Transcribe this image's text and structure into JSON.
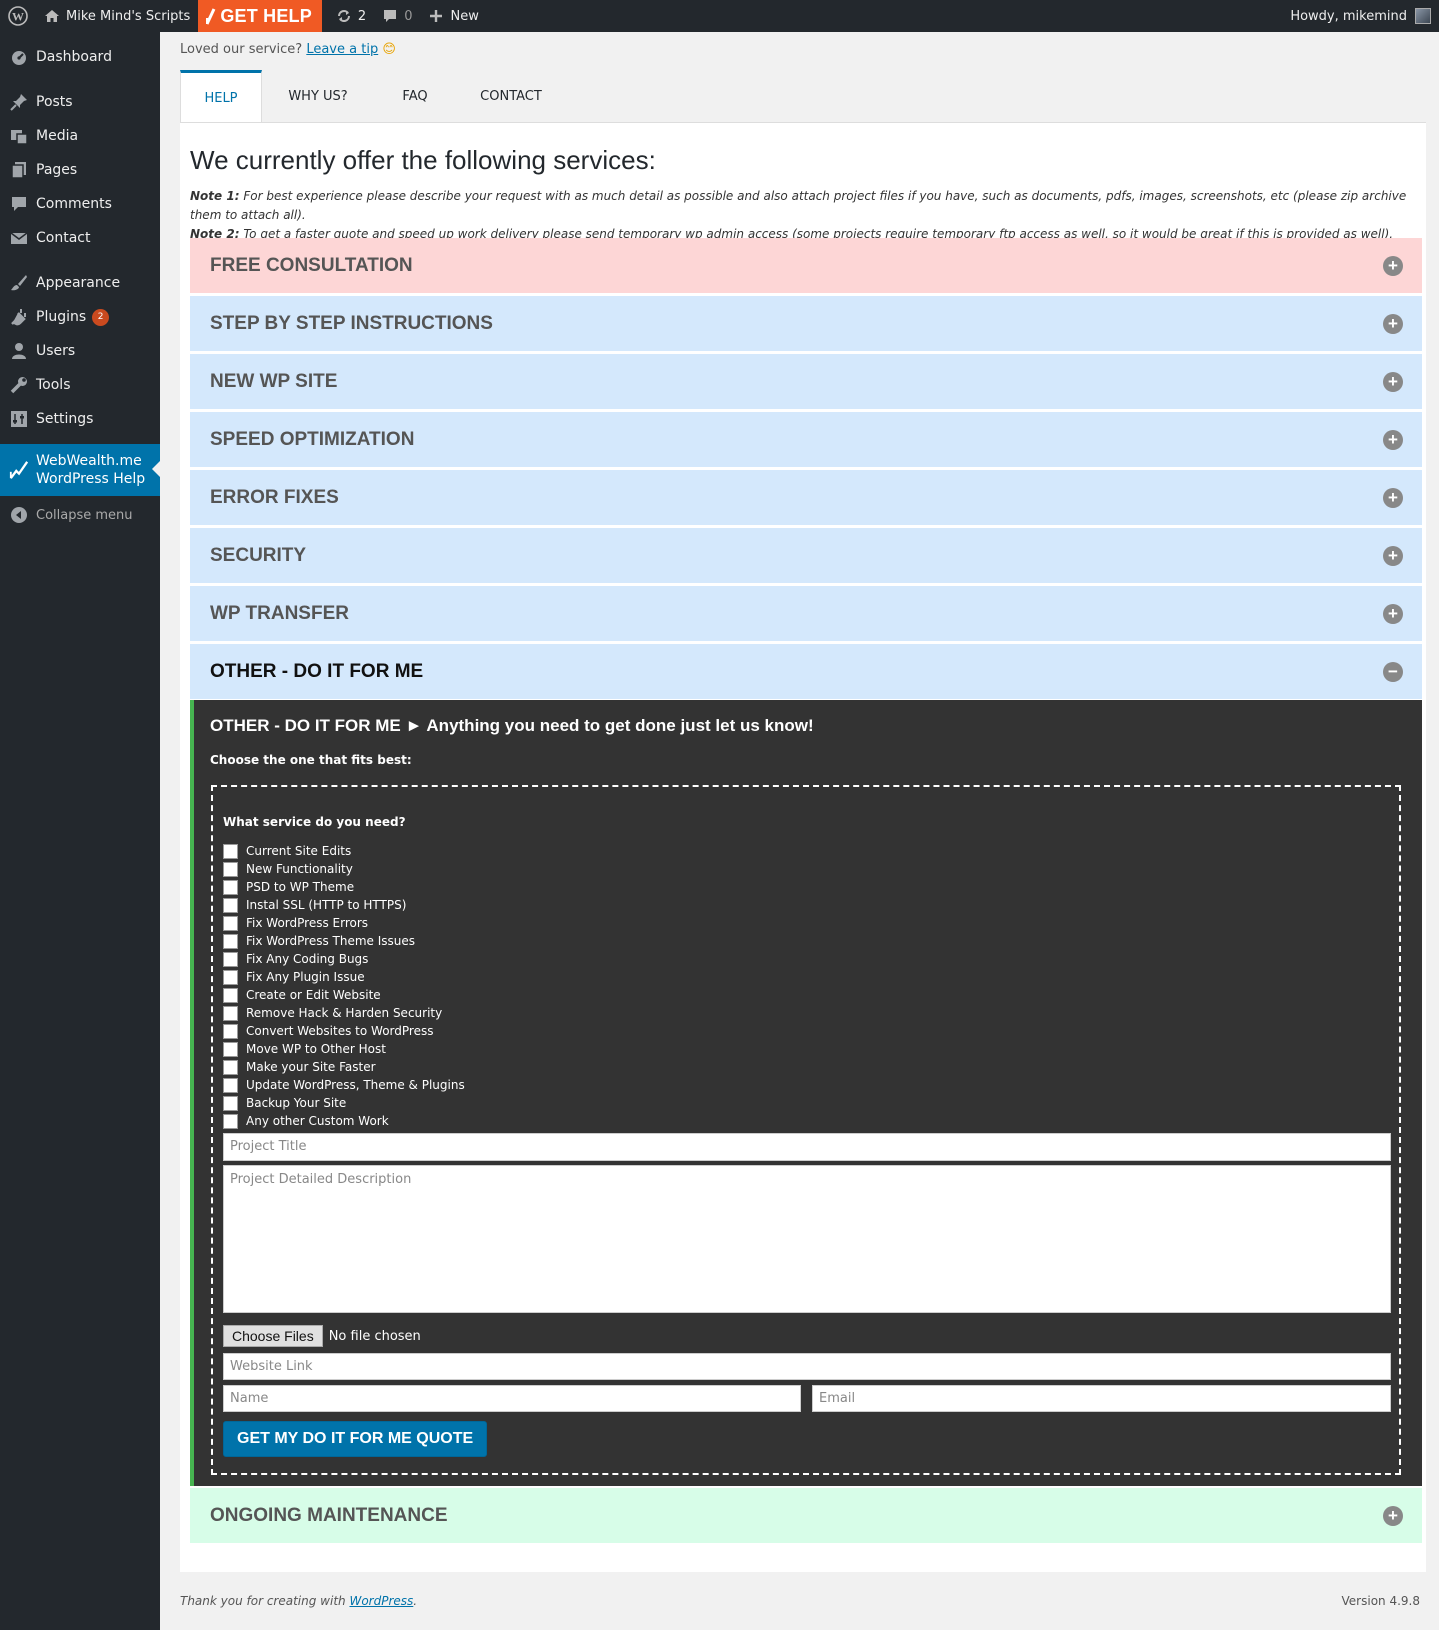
{
  "adminbar": {
    "site_name": "Mike Mind's Scripts",
    "get_help": "GET HELP",
    "updates_count": "2",
    "comments_count": "0",
    "new_label": "New",
    "howdy": "Howdy, mikemind",
    "brand_color": "#f05a24"
  },
  "sidebar": {
    "items": [
      {
        "label": "Dashboard",
        "icon": "dashboard-icon"
      },
      {
        "label": "Posts",
        "icon": "pin-icon"
      },
      {
        "label": "Media",
        "icon": "media-icon"
      },
      {
        "label": "Pages",
        "icon": "pages-icon"
      },
      {
        "label": "Comments",
        "icon": "comment-icon"
      },
      {
        "label": "Contact",
        "icon": "mail-icon"
      },
      {
        "label": "Appearance",
        "icon": "brush-icon"
      },
      {
        "label": "Plugins",
        "icon": "plugin-icon",
        "badge": "2"
      },
      {
        "label": "Users",
        "icon": "user-icon"
      },
      {
        "label": "Tools",
        "icon": "wrench-icon"
      },
      {
        "label": "Settings",
        "icon": "settings-icon"
      }
    ],
    "active_line1": "WebWealth.me",
    "active_line2": "WordPress Help",
    "collapse": "Collapse menu"
  },
  "tipline": {
    "prefix": "Loved our service?",
    "link": "Leave a tip",
    "emoji": "😊"
  },
  "tabs": [
    "HELP",
    "WHY US?",
    "FAQ",
    "CONTACT"
  ],
  "main": {
    "heading": "We currently offer the following services:",
    "note1_label": "Note 1:",
    "note1": "For best experience please describe your request with as much detail as possible and also attach project files if you have, such as documents, pdfs, images, screenshots, etc (please zip archive them to attach all).",
    "note2_label": "Note 2:",
    "note2": "To get a faster quote and speed up work delivery please send temporary wp admin access (some projects require temporary ftp access as well, so it would be great if this is provided as well).",
    "sections": [
      "FREE CONSULTATION",
      "STEP BY STEP INSTRUCTIONS",
      "NEW WP SITE",
      "SPEED OPTIMIZATION",
      "ERROR FIXES",
      "SECURITY",
      "WP TRANSFER",
      "OTHER - DO IT FOR ME",
      "ONGOING MAINTENANCE"
    ]
  },
  "form": {
    "title": "OTHER - DO IT FOR ME ► Anything you need to get done just let us know!",
    "choose": "Choose the one that fits best:",
    "question": "What service do you need?",
    "options": [
      "Current Site Edits",
      "New Functionality",
      "PSD to WP Theme",
      "Instal SSL (HTTP to HTTPS)",
      "Fix WordPress Errors",
      "Fix WordPress Theme Issues",
      "Fix Any Coding Bugs",
      "Fix Any Plugin Issue",
      "Create or Edit Website",
      "Remove Hack & Harden Security",
      "Convert Websites to WordPress",
      "Move WP to Other Host",
      "Make your Site Faster",
      "Update WordPress, Theme & Plugins",
      "Backup Your Site",
      "Any other Custom Work"
    ],
    "project_title_ph": "Project Title",
    "description_ph": "Project Detailed Description",
    "choose_files": "Choose Files",
    "no_file": "No file chosen",
    "website_ph": "Website Link",
    "name_ph": "Name",
    "email_ph": "Email",
    "submit": "GET MY DO IT FOR ME QUOTE"
  },
  "footer": {
    "thanks": "Thank you for creating with",
    "link": "WordPress",
    "period": ".",
    "version": "Version 4.9.8"
  }
}
